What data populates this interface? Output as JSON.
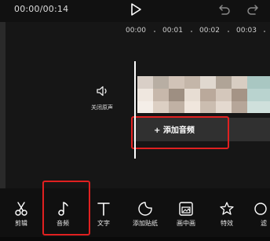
{
  "header": {
    "time": "00:00/00:14",
    "play_icon": "play-icon",
    "undo_icon": "undo-icon",
    "redo_icon": "redo-icon"
  },
  "timeline": {
    "ruler": [
      "00:00",
      "00:01",
      "00:02",
      "00:03"
    ],
    "mute_label": "关闭原声",
    "add_audio_label": "+ 添加音频"
  },
  "toolbar": {
    "items": [
      {
        "label": "剪辑",
        "icon": "scissors-icon"
      },
      {
        "label": "音频",
        "icon": "music-note-icon"
      },
      {
        "label": "文字",
        "icon": "text-icon"
      },
      {
        "label": "添加贴纸",
        "icon": "sticker-icon"
      },
      {
        "label": "画中画",
        "icon": "picture-in-picture-icon"
      },
      {
        "label": "特效",
        "icon": "effects-star-icon"
      },
      {
        "label": "滤",
        "icon": "filter-icon"
      }
    ]
  },
  "colors": {
    "background": "#151515",
    "highlight": "#e02020",
    "add_audio_bg": "#303030"
  }
}
